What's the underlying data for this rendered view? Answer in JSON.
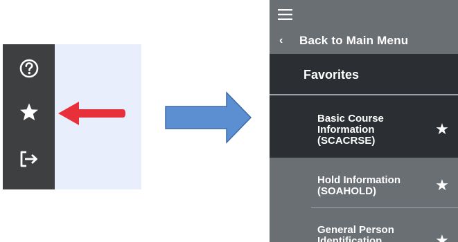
{
  "sidebar": {
    "icons": [
      "help-icon",
      "star-icon",
      "sign-out-icon"
    ]
  },
  "menu": {
    "back_label": "Back to Main Menu",
    "back_chevron": "‹",
    "favorites_label": "Favorites",
    "items": [
      {
        "lines": [
          "Basic Course",
          "Information",
          "(SCACRSE)"
        ],
        "star": "★"
      },
      {
        "lines": [
          "Hold Information",
          "(SOAHOLD)"
        ],
        "star": "★"
      },
      {
        "lines": [
          "General Person",
          "Identification"
        ],
        "star": "★"
      }
    ]
  },
  "colors": {
    "sidebar_bg": "#3e3f41",
    "panel_bg": "#e8eefb",
    "menu_bg": "#6a6f74",
    "selected_bg": "#2b2f33",
    "red_arrow": "#e8303a",
    "blue_arrow": "#5b8fd1"
  }
}
